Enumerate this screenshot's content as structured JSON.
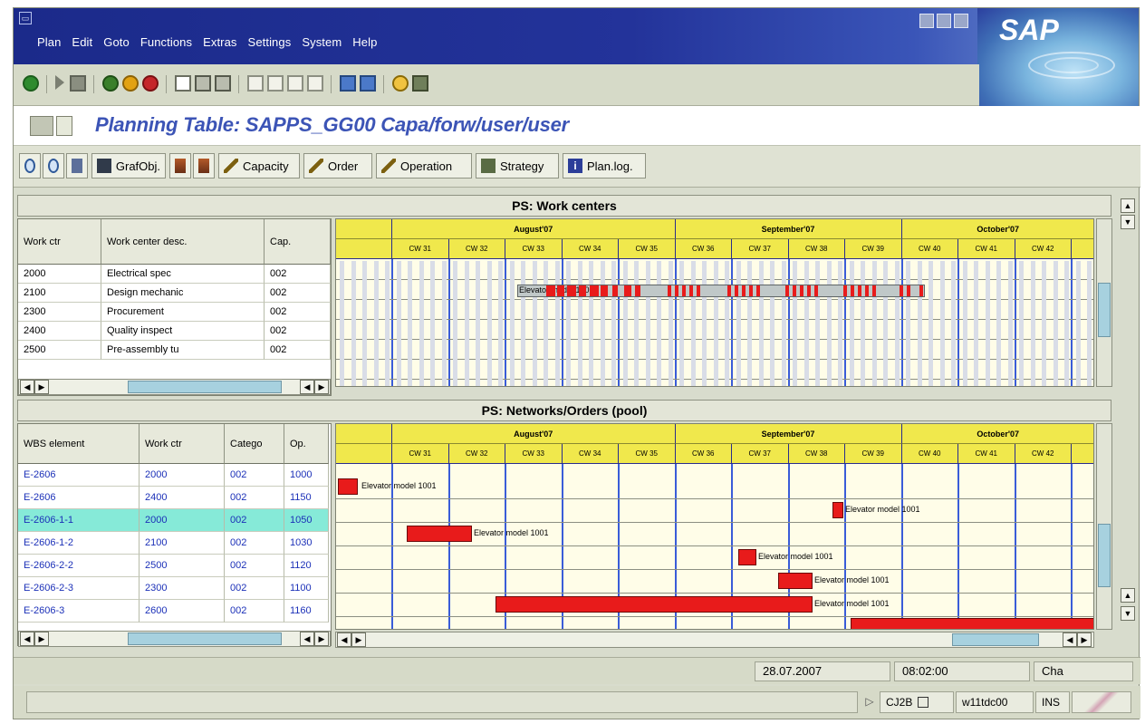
{
  "menu": [
    "Plan",
    "Edit",
    "Goto",
    "Functions",
    "Extras",
    "Settings",
    "System",
    "Help"
  ],
  "brand": "SAP",
  "title": "Planning Table: SAPPS_GG00 Capa/forw/user/user",
  "app_toolbar": {
    "grafobj": "GrafObj.",
    "capacity": "Capacity",
    "order": "Order",
    "operation": "Operation",
    "strategy": "Strategy",
    "planlog": "Plan.log."
  },
  "work_centers": {
    "header": "PS: Work centers",
    "columns": [
      "Work ctr",
      "Work center desc.",
      "Cap."
    ],
    "rows": [
      [
        "2000",
        "Electrical spec",
        "002"
      ],
      [
        "2100",
        "Design mechanic",
        "002"
      ],
      [
        "2300",
        "Procurement",
        "002"
      ],
      [
        "2400",
        "Quality inspect",
        "002"
      ],
      [
        "2500",
        "Pre-assembly tu",
        "002"
      ]
    ]
  },
  "pool": {
    "header": "PS: Networks/Orders (pool)",
    "columns": [
      "WBS element",
      "Work ctr",
      "Catego",
      "Op."
    ],
    "rows": [
      [
        "E-2606",
        "2000",
        "002",
        "1000"
      ],
      [
        "E-2606",
        "2400",
        "002",
        "1150"
      ],
      [
        "E-2606-1-1",
        "2000",
        "002",
        "1050"
      ],
      [
        "E-2606-1-2",
        "2100",
        "002",
        "1030"
      ],
      [
        "E-2606-2-2",
        "2500",
        "002",
        "1120"
      ],
      [
        "E-2606-2-3",
        "2300",
        "002",
        "1100"
      ],
      [
        "E-2606-3",
        "2600",
        "002",
        "1160"
      ]
    ],
    "selected_row": 2
  },
  "timeline": {
    "months": [
      "August'07",
      "September'07",
      "October'07"
    ],
    "weeks": [
      "CW 31",
      "CW 32",
      "CW 33",
      "CW 34",
      "CW 35",
      "CW 36",
      "CW 37",
      "CW 38",
      "CW 39",
      "CW 40",
      "CW 41",
      "CW 42",
      "CW"
    ]
  },
  "bar_label": "Elevator model 1001",
  "status": {
    "date": "28.07.2007",
    "time": "08:02:00",
    "cha": "Cha",
    "transaction": "CJ2B",
    "server": "w11tdc00",
    "mode": "INS"
  },
  "colors": {
    "title_blue": "#3c54b6",
    "bar_red": "#e81b1b",
    "timescale_yellow": "#f0e84c",
    "week_line_blue": "#3a5cd8",
    "selected_row": "#86ead8"
  }
}
